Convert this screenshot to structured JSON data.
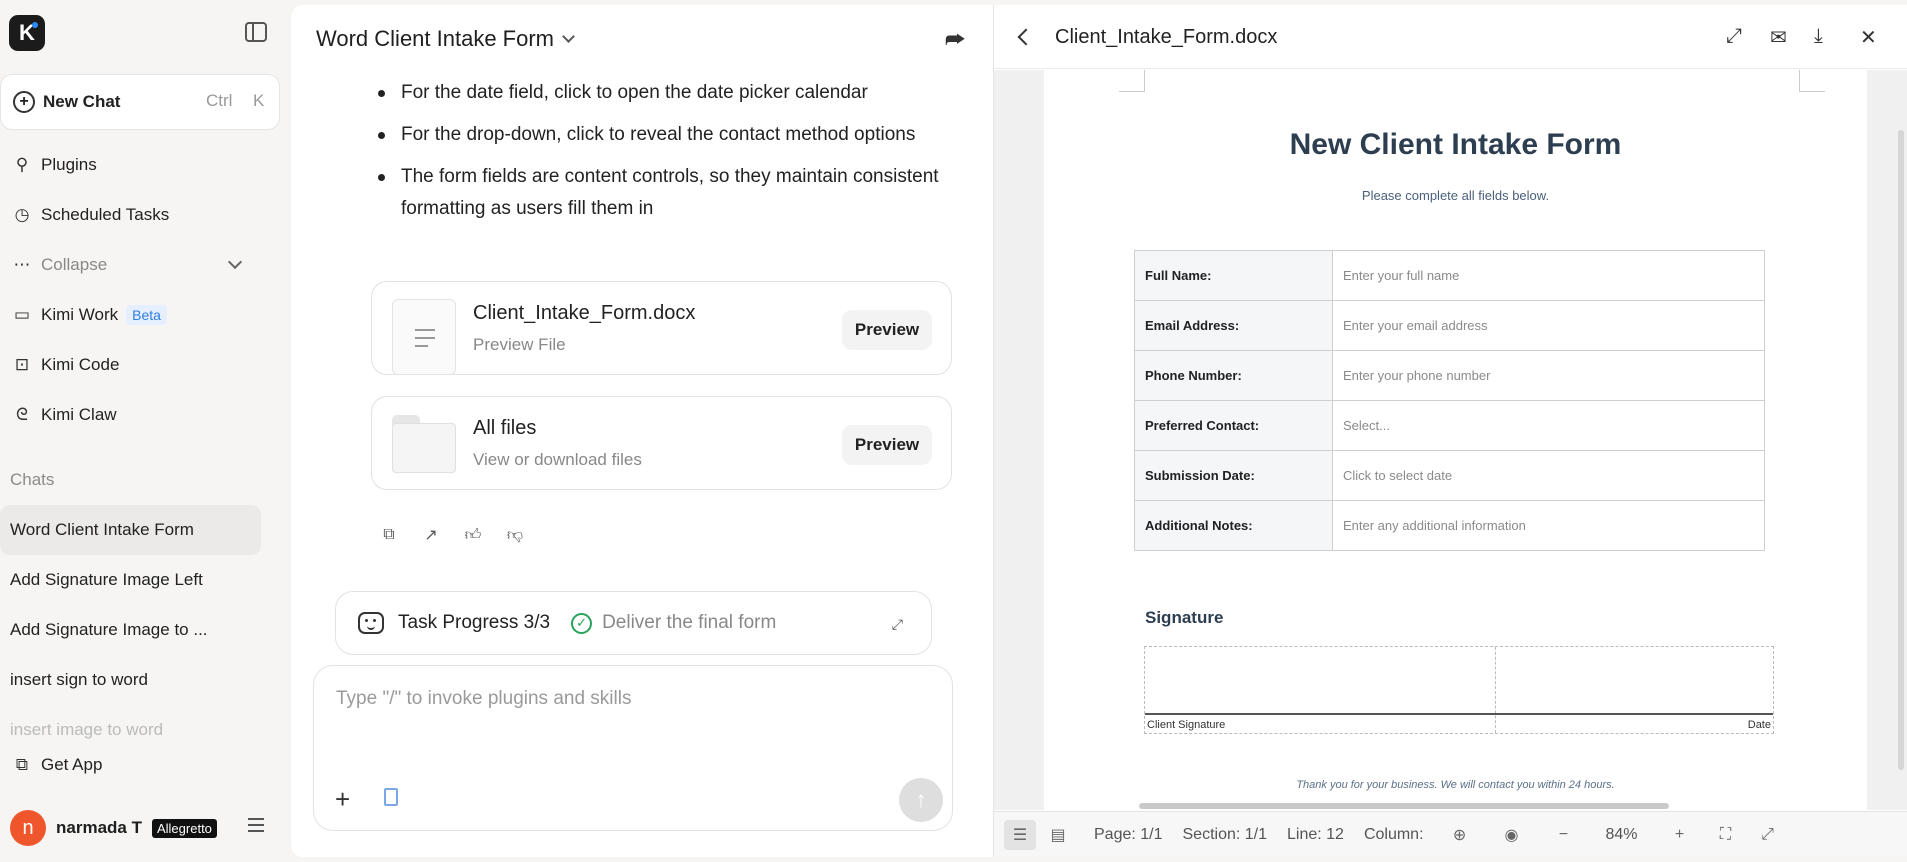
{
  "sidebar": {
    "logo": "K",
    "new_chat": {
      "label": "New Chat",
      "key1": "Ctrl",
      "key2": "K"
    },
    "nav": [
      {
        "label": "Plugins",
        "icon": "plugin-icon"
      },
      {
        "label": "Scheduled Tasks",
        "icon": "clock-icon"
      },
      {
        "label": "Collapse",
        "icon": "more-icon"
      },
      {
        "label": "Kimi Work",
        "icon": "monitor-icon",
        "badge": "Beta"
      },
      {
        "label": "Kimi Code",
        "icon": "terminal-icon"
      },
      {
        "label": "Kimi Claw",
        "icon": "claw-icon"
      }
    ],
    "chats_label": "Chats",
    "chats": [
      "Word Client Intake Form",
      "Add Signature Image Left",
      "Add Signature Image to ...",
      "insert sign to word",
      "insert image to word"
    ],
    "get_app": "Get App",
    "user": {
      "initial": "n",
      "name": "narmada T",
      "plan": "Allegretto"
    }
  },
  "chat": {
    "title": "Word Client Intake Form",
    "bullets": [
      "For the date field, click to open the date picker calendar",
      "For the drop-down, click to reveal the contact method options",
      "The form fields are content controls, so they maintain consistent formatting as users fill them in"
    ],
    "files": [
      {
        "name": "Client_Intake_Form.docx",
        "sub": "Preview File",
        "button": "Preview"
      },
      {
        "name": "All files",
        "sub": "View or download files",
        "button": "Preview"
      }
    ],
    "task": {
      "label": "Task Progress 3/3",
      "step": "Deliver the final form"
    },
    "composer_placeholder": "Type \"/\" to invoke plugins and skills"
  },
  "preview": {
    "filename": "Client_Intake_Form.docx",
    "doc": {
      "title": "New Client Intake Form",
      "subtitle": "Please complete all fields below.",
      "fields": [
        {
          "label": "Full Name:",
          "value": "Enter your full name"
        },
        {
          "label": "Email Address:",
          "value": "Enter your email address"
        },
        {
          "label": "Phone Number:",
          "value": "Enter your phone number"
        },
        {
          "label": "Preferred Contact:",
          "value": "Select..."
        },
        {
          "label": "Submission Date:",
          "value": "Click to select date"
        },
        {
          "label": "Additional Notes:",
          "value": "Enter any additional information"
        }
      ],
      "signature_heading": "Signature",
      "client_signature": "Client Signature",
      "date_label": "Date",
      "footer": "Thank you for your business. We will contact you within 24 hours."
    },
    "status": {
      "page": "Page: 1/1",
      "section": "Section: 1/1",
      "line": "Line: 12",
      "column": "Column:",
      "zoom": "84%"
    }
  }
}
